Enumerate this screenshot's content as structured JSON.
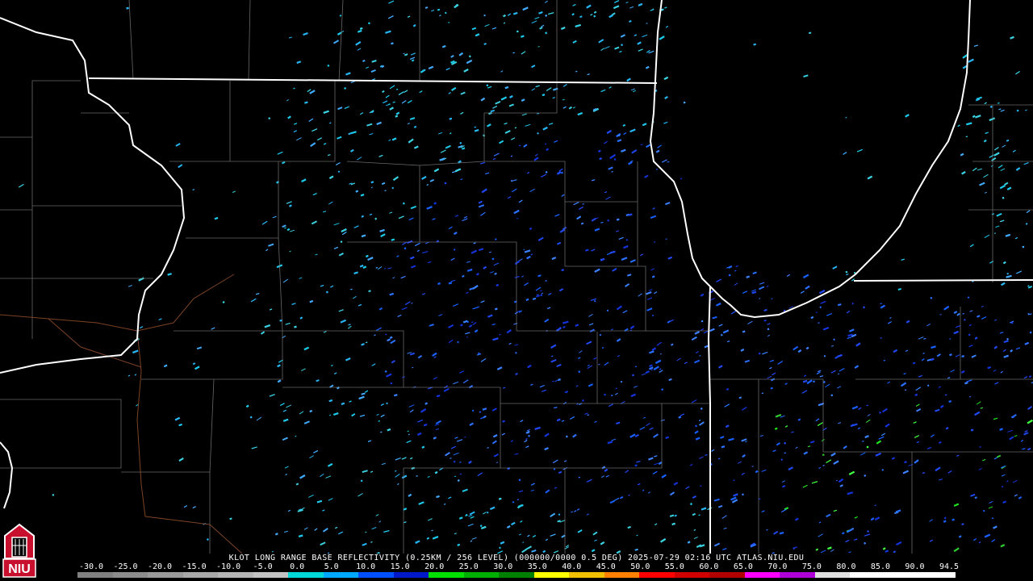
{
  "map": {
    "product_caption": "KLOT LONG RANGE BASE REFLECTIVITY (0.25KM / 256 LEVEL) (000000/0000 0.5 DEG) 2025-07-29 02:16 UTC  ATLAS.NIU.EDU",
    "logo_text": "NIU",
    "colors": {
      "background": "#000000",
      "state_lines": "#ffffff",
      "county_lines": "#7a7a7a",
      "interstates": "#8a4a2a",
      "logo_red": "#c8102e"
    }
  },
  "legend": {
    "labels": [
      "-30.0",
      "-25.0",
      "-20.0",
      "-15.0",
      "-10.0",
      "-5.0",
      "0.0",
      "5.0",
      "10.0",
      "15.0",
      "20.0",
      "25.0",
      "30.0",
      "35.0",
      "40.0",
      "45.0",
      "50.0",
      "55.0",
      "60.0",
      "65.0",
      "70.0",
      "75.0",
      "80.0",
      "85.0",
      "90.0",
      "94.5"
    ],
    "colors": [
      "#808080",
      "#8c8c8c",
      "#9a9a9a",
      "#a8a8a8",
      "#b5b5b5",
      "#c2c2c2",
      "#00d8d8",
      "#00a8ff",
      "#0050ff",
      "#0018c8",
      "#00e000",
      "#00b000",
      "#008000",
      "#ffff00",
      "#f0c000",
      "#ff8000",
      "#ff0000",
      "#d00000",
      "#b00000",
      "#ff00ff",
      "#b000d8",
      "#e0e0e0",
      "#ffffff",
      "#ffffff",
      "#ffffff"
    ]
  }
}
